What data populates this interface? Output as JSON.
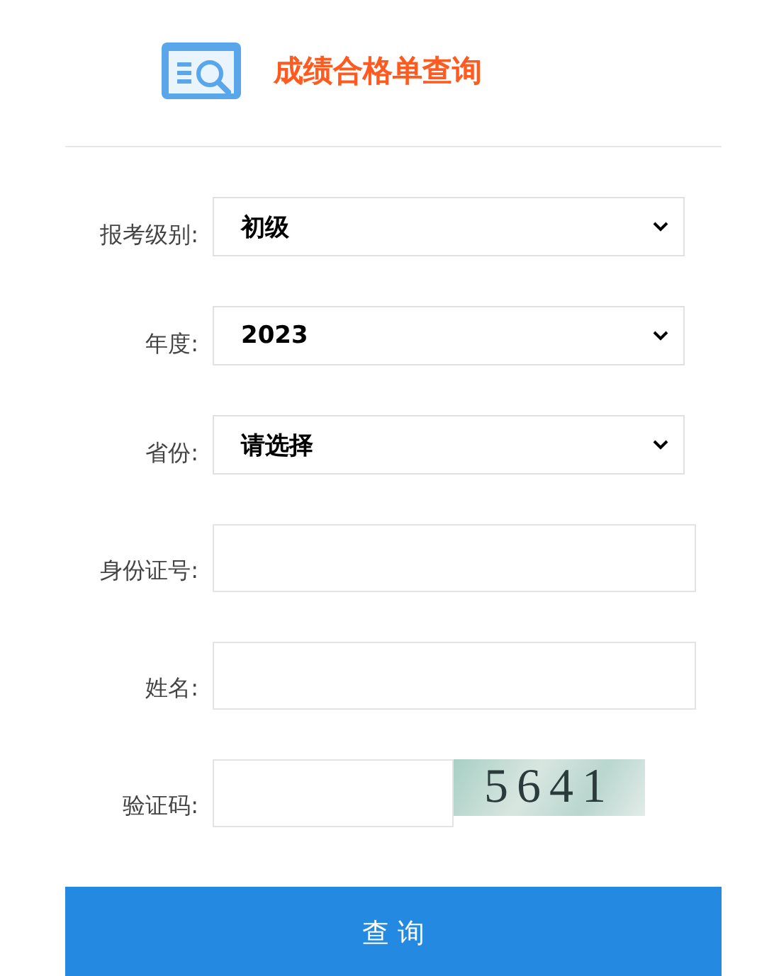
{
  "header": {
    "title": "成绩合格单查询"
  },
  "fields": [
    {
      "kind": "select",
      "label": "报考级别:",
      "value": "初级"
    },
    {
      "kind": "select",
      "label": "年度:",
      "value": "2023"
    },
    {
      "kind": "select",
      "label": "省份:",
      "value": "请选择"
    },
    {
      "kind": "input",
      "label": "身份证号:"
    },
    {
      "kind": "input",
      "label": "姓名:"
    },
    {
      "kind": "captcha",
      "label": "验证码:",
      "code": "5641"
    }
  ],
  "submit": "查 询"
}
